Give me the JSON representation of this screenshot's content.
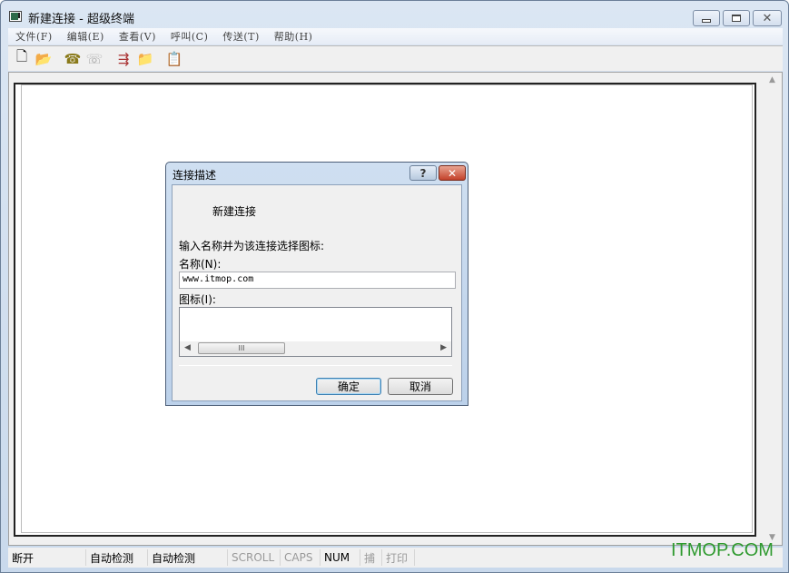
{
  "window": {
    "title": "新建连接 - 超级终端",
    "caption_buttons": {
      "minimize": "minimize",
      "maximize": "maximize",
      "close": "✕"
    }
  },
  "menu": [
    {
      "label": "文件(F)"
    },
    {
      "label": "编辑(E)"
    },
    {
      "label": "查看(V)"
    },
    {
      "label": "呼叫(C)"
    },
    {
      "label": "传送(T)"
    },
    {
      "label": "帮助(H)"
    }
  ],
  "toolbar": [
    {
      "icon": "new-document-icon",
      "glyph": "🗋"
    },
    {
      "icon": "open-folder-icon",
      "glyph": "📂"
    },
    {
      "icon": "call-phone-icon",
      "glyph": "☎"
    },
    {
      "icon": "disconnect-icon",
      "glyph": "☏"
    },
    {
      "icon": "send-file-icon",
      "glyph": "⇶"
    },
    {
      "icon": "receive-file-icon",
      "glyph": "📁"
    },
    {
      "icon": "properties-icon",
      "glyph": "📋"
    }
  ],
  "dialog": {
    "title": "连接描述",
    "help_label": "?",
    "close_label": "✕",
    "heading": "新建连接",
    "prompt": "输入名称并为该连接选择图标:",
    "name_label": "名称(N):",
    "name_value": "www.itmop.com",
    "icon_label": "图标(I):",
    "scroll_thumb": "III",
    "ok_label": "确定",
    "cancel_label": "取消"
  },
  "statusbar": [
    {
      "label": "断开",
      "dim": false
    },
    {
      "label": "自动检测",
      "dim": false
    },
    {
      "label": "自动检测",
      "dim": false
    },
    {
      "label": "SCROLL",
      "dim": true
    },
    {
      "label": "CAPS",
      "dim": true
    },
    {
      "label": "NUM",
      "dim": false
    },
    {
      "label": "捕",
      "dim": true
    },
    {
      "label": "打印",
      "dim": true
    }
  ],
  "watermark": "ITMOP.COM",
  "colors": {
    "watermark": "#2f9a2f",
    "close_button": "#c3412a"
  }
}
